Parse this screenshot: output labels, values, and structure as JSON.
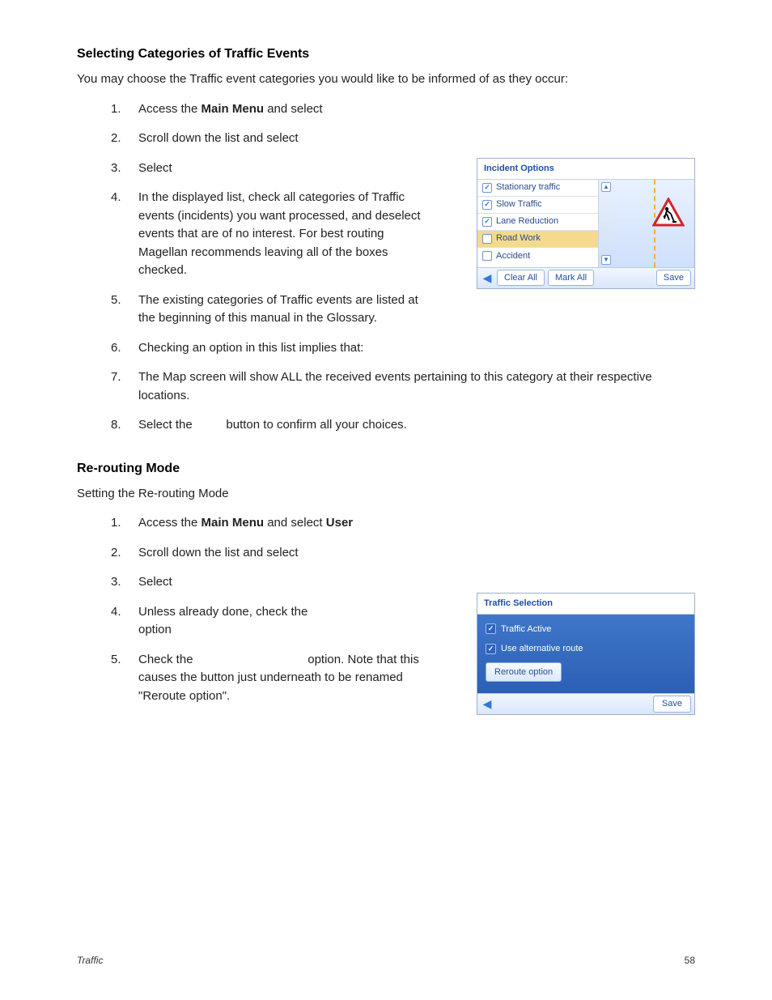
{
  "section1": {
    "heading": "Selecting Categories of Traffic Events",
    "intro": "You may choose the Traffic event categories you would like to be informed of as they occur:",
    "steps": {
      "s1_pre": "Access the ",
      "s1_bold": "Main Menu",
      "s1_post": " and select",
      "s2": "Scroll down the list and select",
      "s3": "Select",
      "s4": "In the displayed list, check all categories of Traffic events (incidents) you want processed, and deselect events that are of no interest. For best routing Magellan recommends leaving all of the boxes checked.",
      "s5": "The existing categories of Traffic events are listed at the beginning of this manual in the Glossary.",
      "s6": "Checking an option in this list implies that:",
      "s7": "The Map screen will show ALL the received events pertaining to this category at their respective locations.",
      "s8_pre": "Select the ",
      "s8_post": " button to confirm all your choices."
    }
  },
  "shot1": {
    "title": "Incident Options",
    "items": [
      {
        "label": "Stationary traffic",
        "checked": true
      },
      {
        "label": "Slow Traffic",
        "checked": true
      },
      {
        "label": "Lane Reduction",
        "checked": true
      },
      {
        "label": "Road Work",
        "checked": false,
        "selected": true
      },
      {
        "label": "Accident",
        "checked": false
      }
    ],
    "buttons": {
      "clear": "Clear All",
      "mark": "Mark All",
      "save": "Save"
    }
  },
  "section2": {
    "heading": "Re-routing Mode",
    "intro": "Setting the Re-routing Mode",
    "steps": {
      "s1_pre": "Access the ",
      "s1_b1": "Main Menu",
      "s1_mid": " and select ",
      "s1_b2": "User",
      "s2": "Scroll down the list and select",
      "s3": "Select",
      "s4a": "Unless already done, check the ",
      "s4b": "option",
      "s5a": "Check the ",
      "s5b": " option. Note that this causes the button just underneath to be renamed \"Reroute option\"."
    }
  },
  "shot2": {
    "title": "Traffic Selection",
    "opt1": "Traffic Active",
    "opt2": "Use alternative route",
    "reroute": "Reroute option",
    "save": "Save"
  },
  "footer": {
    "label": "Traffic",
    "page": "58"
  }
}
